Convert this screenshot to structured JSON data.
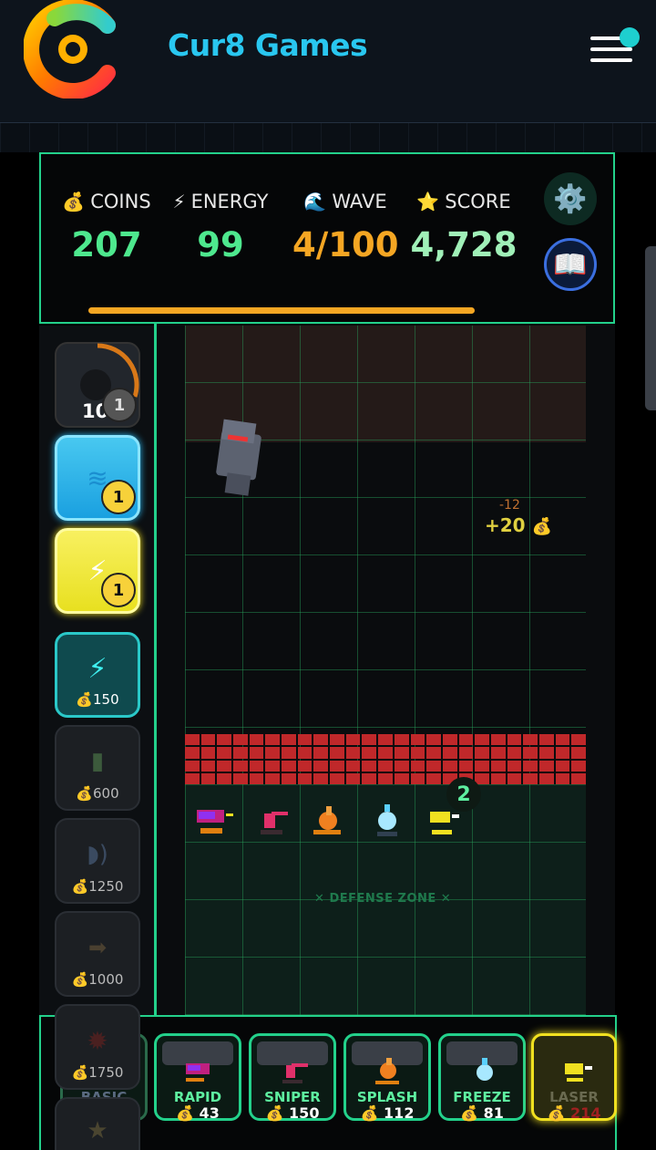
{
  "header": {
    "brand": "Cur8 Games",
    "menu_notification": true
  },
  "stats": {
    "coins": {
      "label": "COINS",
      "value": "207",
      "icon": "money-bag-icon",
      "color": "#4ee88e"
    },
    "energy": {
      "label": "ENERGY",
      "value": "99",
      "icon": "lightning-icon",
      "color": "#4ee88e"
    },
    "wave": {
      "label": "WAVE",
      "value": "4/100",
      "icon": "wave-icon",
      "color": "#f5a623"
    },
    "score": {
      "label": "SCORE",
      "value": "4,728",
      "icon": "star-icon",
      "color": "#a0f0b8"
    },
    "wave_progress": 1.0
  },
  "powerups": [
    {
      "id": "bomb",
      "count": "10",
      "badge": "1"
    },
    {
      "id": "water",
      "badge": "1"
    },
    {
      "id": "heal-lightning",
      "badge": "1"
    },
    {
      "id": "lightning",
      "cost": "150"
    },
    {
      "id": "battery",
      "cost": "600"
    },
    {
      "id": "sonic",
      "cost": "1250"
    },
    {
      "id": "dash",
      "cost": "1000"
    },
    {
      "id": "burst",
      "cost": "1750"
    },
    {
      "id": "star",
      "cost": ""
    }
  ],
  "board": {
    "floating_reward": "+20",
    "floating_damage": "-12",
    "defense_zone_label": "DEFENSE ZONE",
    "tower_count_badge": "2"
  },
  "towers": [
    {
      "name": "BASIC",
      "price": ""
    },
    {
      "name": "RAPID",
      "price": "43"
    },
    {
      "name": "SNIPER",
      "price": "150"
    },
    {
      "name": "SPLASH",
      "price": "112"
    },
    {
      "name": "FREEZE",
      "price": "81"
    },
    {
      "name": "LASER",
      "price": "214"
    }
  ]
}
